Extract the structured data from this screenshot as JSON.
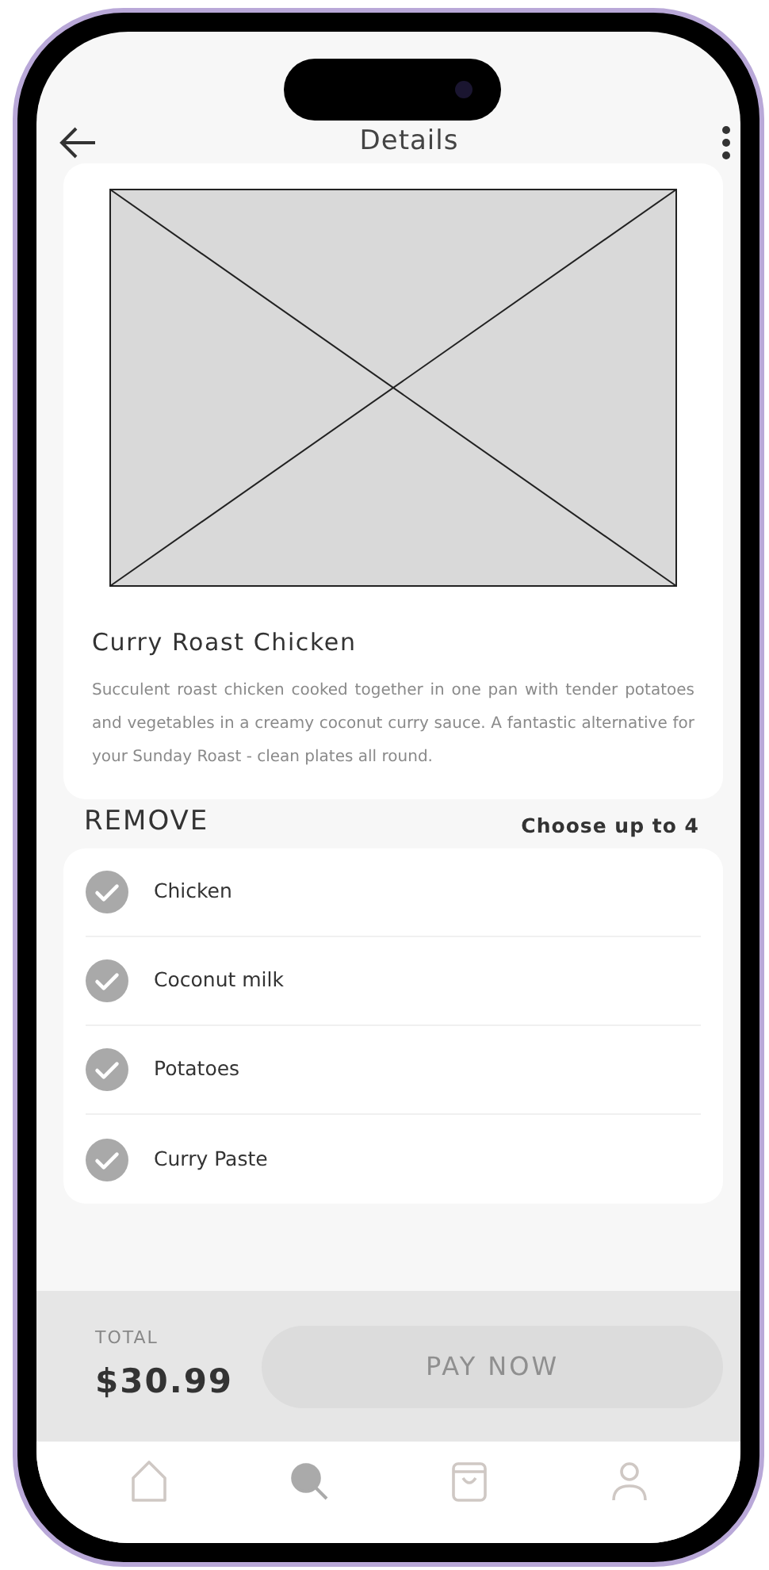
{
  "header": {
    "title": "Details"
  },
  "dish": {
    "name": "Curry Roast Chicken",
    "description": "Succulent roast chicken cooked together in one pan with tender potatoes and vegetables in a creamy coconut curry sauce. A fantastic alternative for your Sunday Roast - clean plates all round."
  },
  "remove": {
    "title": "REMOVE",
    "hint": "Choose up to 4",
    "items": [
      {
        "label": "Chicken",
        "checked": true
      },
      {
        "label": "Coconut milk",
        "checked": true
      },
      {
        "label": "Potatoes",
        "checked": true
      },
      {
        "label": "Curry Paste",
        "checked": true
      }
    ]
  },
  "checkout": {
    "total_label": "TOTAL",
    "total": "$30.99",
    "button": "PAY NOW",
    "disabled": true
  },
  "nav": [
    {
      "kind": "home",
      "selected": false
    },
    {
      "kind": "search",
      "selected": true
    },
    {
      "kind": "bag",
      "selected": false
    },
    {
      "kind": "profile",
      "selected": false
    }
  ]
}
